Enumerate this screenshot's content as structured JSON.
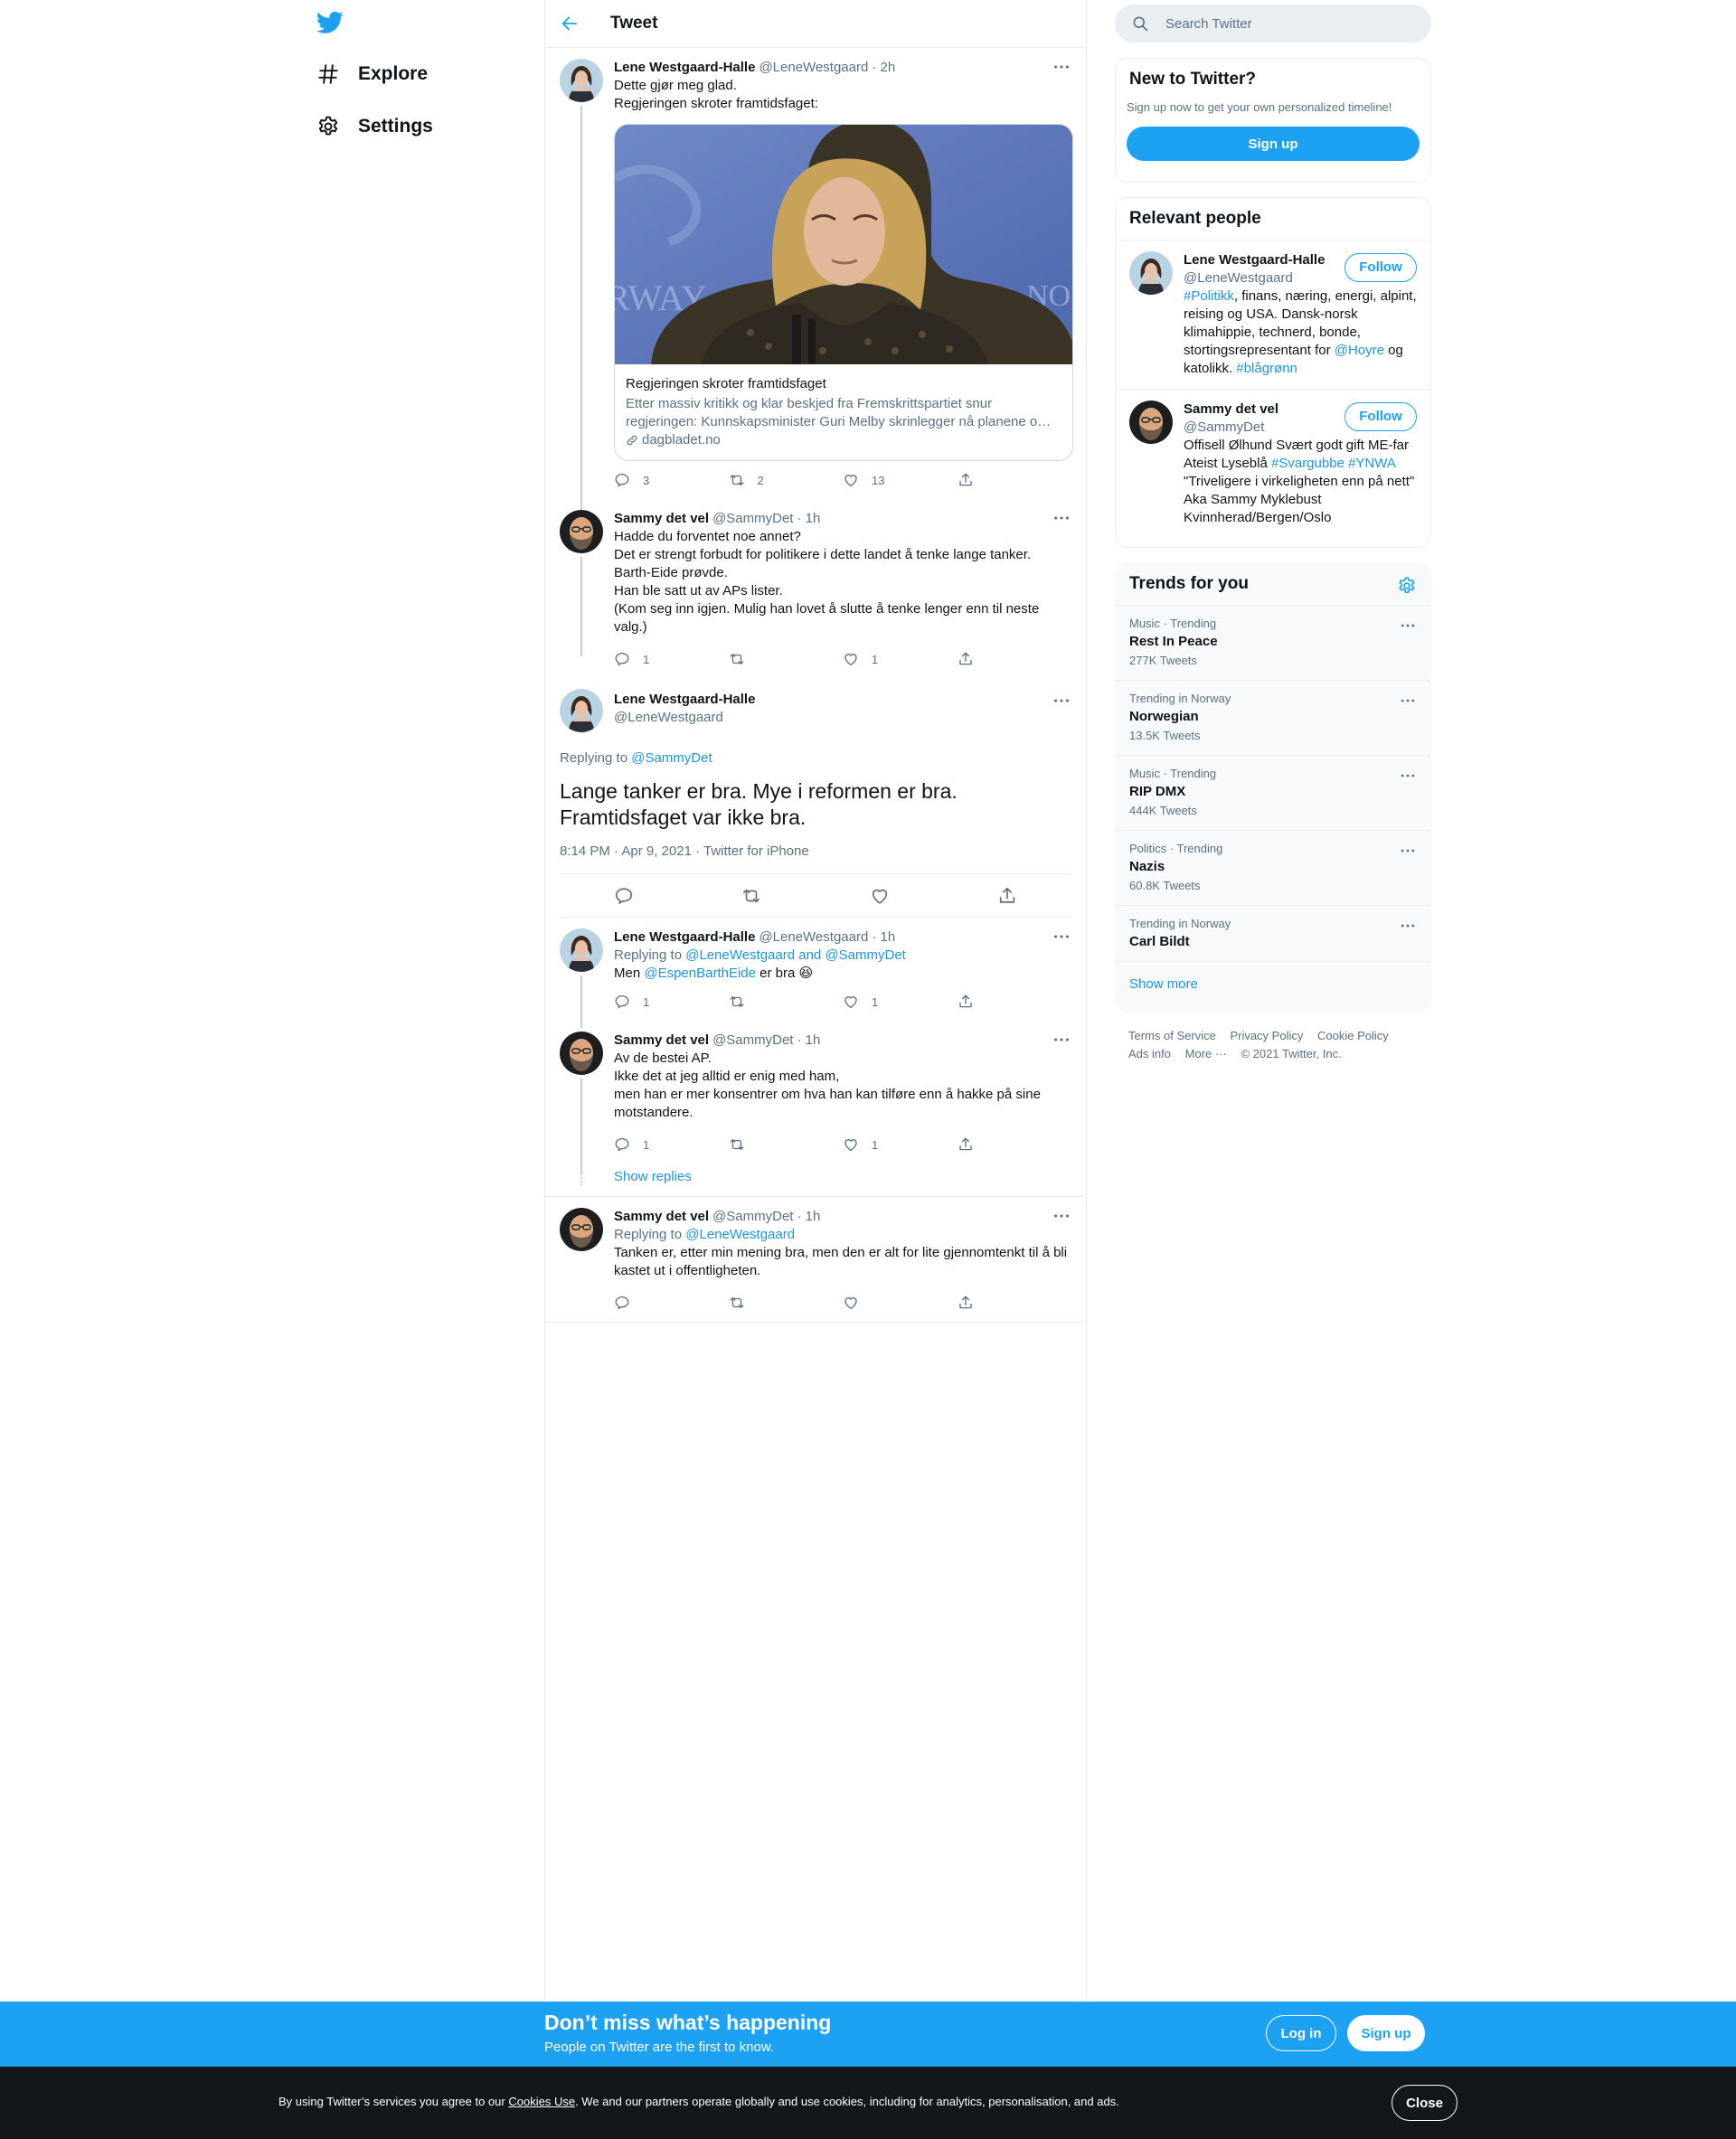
{
  "nav": {
    "items": [
      {
        "label": "Explore",
        "icon": "hashtag-icon"
      },
      {
        "label": "Settings",
        "icon": "gear-icon"
      }
    ]
  },
  "header": {
    "title": "Tweet"
  },
  "thread": [
    {
      "name": "Lene Westgaard-Halle",
      "handle": "@LeneWestgaard",
      "time": "· 2h",
      "text": "Dette gjør meg glad.\nRegjeringen skroter framtidsfaget:",
      "card": {
        "title": "Regjeringen skroter framtidsfaget",
        "description": "Etter massiv kritikk og klar beskjed fra Fremskrittspartiet snur regjeringen: Kunnskapsminister Guri Melby skrinlegger nå planene o…",
        "domain": "dagbladet.no"
      },
      "replies": "3",
      "retweets": "2",
      "likes": "13"
    },
    {
      "name": "Sammy det vel",
      "handle": "@SammyDet",
      "time": "· 1h",
      "text": "Hadde du forventet noe annet?\nDet er strengt forbudt for politikere i dette landet å tenke lange tanker.\nBarth-Eide prøvde.\nHan ble satt ut av APs lister.\n(Kom seg inn igjen. Mulig han lovet å slutte å tenke lenger enn til neste valg.)",
      "replies": "1",
      "retweets": "",
      "likes": "1"
    }
  ],
  "main_tweet": {
    "name": "Lene Westgaard-Halle",
    "handle": "@LeneWestgaard",
    "replying_prefix": "Replying to ",
    "replying_to": "@SammyDet",
    "text": "Lange tanker er bra. Mye i reformen er bra.\nFramtidsfaget var ikke bra.",
    "meta": "8:14 PM · Apr 9, 2021 · Twitter for iPhone"
  },
  "replies": [
    {
      "name": "Lene Westgaard-Halle",
      "handle": "@LeneWestgaard",
      "time": "· 1h",
      "replying_prefix": "Replying to ",
      "replying_to": "@LeneWestgaard and @SammyDet",
      "text_before": "Men ",
      "mention": "@EspenBarthEide",
      "text_after": " er bra ",
      "emoji": "😆",
      "replies": "1",
      "retweets": "",
      "likes": "1"
    },
    {
      "name": "Sammy det vel",
      "handle": "@SammyDet",
      "time": "· 1h",
      "text": "Av de bestei AP.\nIkke det at jeg alltid er enig med ham,\nmen han er mer konsentrer om hva han kan tilføre enn å hakke på sine motstandere.",
      "replies": "1",
      "retweets": "",
      "likes": "1"
    },
    {
      "show_replies": "Show replies"
    },
    {
      "name": "Sammy det vel",
      "handle": "@SammyDet",
      "time": "· 1h",
      "replying_prefix": "Replying to ",
      "replying_to": "@LeneWestgaard",
      "text": "Tanken er, etter min mening bra, men den er alt for lite gjennomtenkt til å bli kastet ut i offentligheten.",
      "replies": "",
      "retweets": "",
      "likes": ""
    }
  ],
  "search": {
    "placeholder": "Search Twitter"
  },
  "new_to_twitter": {
    "title": "New to Twitter?",
    "subtitle": "Sign up now to get your own personalized timeline!",
    "button": "Sign up"
  },
  "relevant_people": {
    "title": "Relevant people",
    "people": [
      {
        "name": "Lene Westgaard-Halle",
        "handle": "@LeneWestgaard",
        "button": "Follow",
        "bio_1": "#Politikk",
        "bio_2": ", finans, næring, energi, alpint, reising og USA. Dansk-norsk klimahippie, technerd, bonde, stortingsrepresentant for ",
        "bio_3": "@Hoyre",
        "bio_4": " og katolikk. ",
        "bio_5": "#blågrønn"
      },
      {
        "name": "Sammy det vel",
        "handle": "@SammyDet",
        "button": "Follow",
        "bio_1": "Offisell Ølhund Svært godt gift ME-far Ateist Lyseblå ",
        "bio_2": "#Svargubbe",
        "bio_3": " ",
        "bio_4": "#YNWA",
        "bio_5": " \"Triveligere i virkeligheten enn på nett\" Aka Sammy Myklebust Kvinnherad/Bergen/Oslo"
      }
    ]
  },
  "trends": {
    "title": "Trends for you",
    "items": [
      {
        "meta": "Music · Trending",
        "name": "Rest In Peace",
        "count": "277K Tweets"
      },
      {
        "meta": "Trending in Norway",
        "name": "Norwegian",
        "count": "13.5K Tweets"
      },
      {
        "meta": "Music · Trending",
        "name": "RIP DMX",
        "count": "444K Tweets"
      },
      {
        "meta": "Politics · Trending",
        "name": "Nazis",
        "count": "60.8K Tweets"
      },
      {
        "meta": "Trending in Norway",
        "name": "Carl Bildt",
        "count": ""
      }
    ],
    "show_more": "Show more"
  },
  "footer": {
    "links": [
      "Terms of Service",
      "Privacy Policy",
      "Cookie Policy",
      "Ads info",
      "More ···"
    ],
    "copyright": "© 2021 Twitter, Inc."
  },
  "signup_bar": {
    "headline": "Don’t miss what’s happening",
    "subline": "People on Twitter are the first to know.",
    "login": "Log in",
    "signup": "Sign up"
  },
  "cookie_bar": {
    "text_before": "By using Twitter’s services you agree to our ",
    "link": "Cookies Use",
    "text_after": ". We and our partners operate globally and use cookies, including for analytics, personalisation, and ads.",
    "close": "Close"
  },
  "colors": {
    "accent": "#1da1f2",
    "link": "#1b95e0",
    "secondary_text": "#5b7083",
    "cookie_bar_bg": "#14171a"
  }
}
